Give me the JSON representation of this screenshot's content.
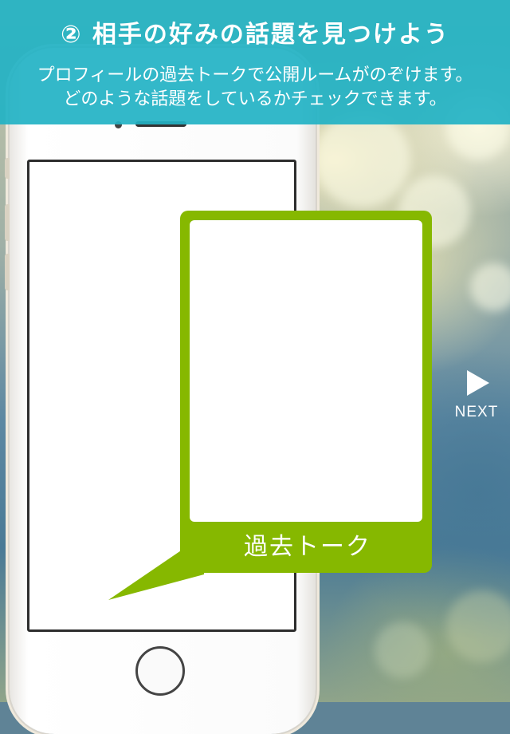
{
  "header": {
    "title": "② 相手の好みの話題を見つけよう",
    "description_line1": "プロフィールの過去トークで公開ルームがのぞけます。",
    "description_line2": "どのような話題をしているかチェックできます。"
  },
  "callout": {
    "label": "過去トーク"
  },
  "navigation": {
    "next_label": "NEXT"
  },
  "colors": {
    "header_band": "#22b2c4",
    "callout_green": "#86b800",
    "text_light": "#ffffff"
  },
  "icons": {
    "next": "play-triangle-icon"
  }
}
